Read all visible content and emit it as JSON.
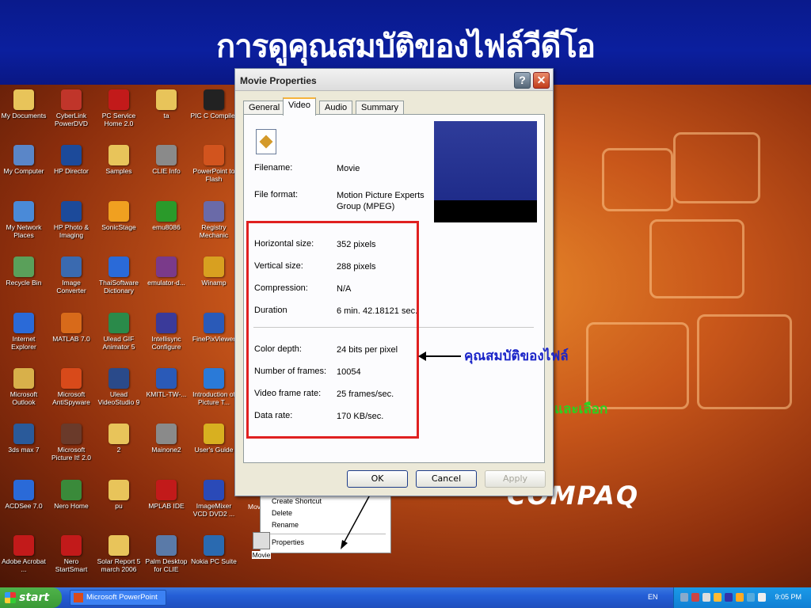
{
  "slide": {
    "title": "การดูคุณสมบัติของไฟล์วีดีโอ"
  },
  "desktop": {
    "icons": [
      {
        "label": "My Documents",
        "glyph": "folder-documents-icon",
        "color": "#e8c45a"
      },
      {
        "label": "CyberLink PowerDVD",
        "glyph": "powerdvd-icon",
        "color": "#c0352a"
      },
      {
        "label": "PC Service Home 2.0",
        "glyph": "pc-service-icon",
        "color": "#c21a1a"
      },
      {
        "label": "ta",
        "glyph": "folder-icon",
        "color": "#e8c45a"
      },
      {
        "label": "PIC C Compiler",
        "glyph": "pic-compiler-icon",
        "color": "#222222"
      },
      {
        "label": "My Computer",
        "glyph": "my-computer-icon",
        "color": "#5a86c8"
      },
      {
        "label": "HP Director",
        "glyph": "hp-director-icon",
        "color": "#1c4a9a"
      },
      {
        "label": "Samples",
        "glyph": "folder-icon",
        "color": "#e8c45a"
      },
      {
        "label": "CLIE Info",
        "glyph": "clie-info-icon",
        "color": "#8a8a8a"
      },
      {
        "label": "PowerPoint to Flash",
        "glyph": "ppt-flash-icon",
        "color": "#d2541e"
      },
      {
        "label": "My Network Places",
        "glyph": "network-places-icon",
        "color": "#4a8ad8"
      },
      {
        "label": "HP Photo & Imaging",
        "glyph": "hp-photo-icon",
        "color": "#1c4a9a"
      },
      {
        "label": "SonicStage",
        "glyph": "sonicstage-icon",
        "color": "#f0a020"
      },
      {
        "label": "emu8086",
        "glyph": "emu8086-icon",
        "color": "#2a9a2a"
      },
      {
        "label": "Registry Mechanic",
        "glyph": "registry-icon",
        "color": "#6a6aa8"
      },
      {
        "label": "Recycle Bin",
        "glyph": "recycle-bin-icon",
        "color": "#5aa05a"
      },
      {
        "label": "Image Converter",
        "glyph": "image-converter-icon",
        "color": "#3a6ab0"
      },
      {
        "label": "ThaiSoftware Dictionary",
        "glyph": "dictionary-icon",
        "color": "#2a6ad8"
      },
      {
        "label": "emulator-d...",
        "glyph": "winrar-icon",
        "color": "#7a3a8a"
      },
      {
        "label": "Winamp",
        "glyph": "winamp-icon",
        "color": "#d8a020"
      },
      {
        "label": "Internet Explorer",
        "glyph": "internet-explorer-icon",
        "color": "#2a6ad8"
      },
      {
        "label": "MATLAB 7.0",
        "glyph": "matlab-icon",
        "color": "#d86a1a"
      },
      {
        "label": "Ulead GIF Animator 5",
        "glyph": "gif-animator-icon",
        "color": "#2a8a4a"
      },
      {
        "label": "Intellisync Configure",
        "glyph": "intellisync-icon",
        "color": "#3a3a9a"
      },
      {
        "label": "FinePixViewer",
        "glyph": "finepix-icon",
        "color": "#2a5ab8"
      },
      {
        "label": "Microsoft Outlook",
        "glyph": "outlook-icon",
        "color": "#d8b04a"
      },
      {
        "label": "Microsoft AntiSpyware",
        "glyph": "antispyware-icon",
        "color": "#d84a1a"
      },
      {
        "label": "Ulead VideoStudio 9",
        "glyph": "videostudio-icon",
        "color": "#2a4a8a"
      },
      {
        "label": "KMITL-TW-...",
        "glyph": "word-document-icon",
        "color": "#2a5ab8"
      },
      {
        "label": "Introduction of Picture T...",
        "glyph": "ie-shortcut-icon",
        "color": "#2a7ad8"
      },
      {
        "label": "3ds max 7",
        "glyph": "3dsmax-icon",
        "color": "#2a5a9a"
      },
      {
        "label": "Microsoft Picture It! 2.0",
        "glyph": "picture-it-icon",
        "color": "#6a3a2a"
      },
      {
        "label": "2",
        "glyph": "folder-icon",
        "color": "#e8c45a"
      },
      {
        "label": "Mainone2",
        "glyph": "mainone-icon",
        "color": "#8a8a8a"
      },
      {
        "label": "User's Guide",
        "glyph": "users-guide-icon",
        "color": "#d8b020"
      },
      {
        "label": "ACDSee 7.0",
        "glyph": "acdsee-icon",
        "color": "#2a6ad8"
      },
      {
        "label": "Nero Home",
        "glyph": "nero-home-icon",
        "color": "#3a8a3a"
      },
      {
        "label": "pu",
        "glyph": "folder-icon",
        "color": "#e8c45a"
      },
      {
        "label": "MPLAB IDE",
        "glyph": "mplab-icon",
        "color": "#c21a1a"
      },
      {
        "label": "ImageMixer VCD DVD2 ...",
        "glyph": "imagemixer-icon",
        "color": "#2a4ab8"
      },
      {
        "label": "Adobe Acrobat ...",
        "glyph": "acrobat-icon",
        "color": "#c21a1a"
      },
      {
        "label": "Nero StartSmart",
        "glyph": "nero-icon",
        "color": "#c21a1a"
      },
      {
        "label": "Solar Report 5 march 2006",
        "glyph": "folder-icon",
        "color": "#e8c45a"
      },
      {
        "label": "Palm Desktop for CLIE",
        "glyph": "palm-desktop-icon",
        "color": "#5a7aa8"
      },
      {
        "label": "Nokia PC Suite",
        "glyph": "nokia-suite-icon",
        "color": "#2a6ab0"
      }
    ],
    "movie_file_label": "Movie",
    "partial_label": "Mov",
    "context_menu": {
      "items": [
        "Create Shortcut",
        "Delete",
        "Rename",
        "Properties"
      ]
    },
    "brand_text": "COMPAQ",
    "green_note": "และเลือก"
  },
  "dialog": {
    "title": "Movie Properties",
    "help_label": "?",
    "close_label": "✕",
    "tabs": [
      "General",
      "Video",
      "Audio",
      "Summary"
    ],
    "active_tab": "Video",
    "filename_label": "Filename:",
    "filename_value": "Movie",
    "format_label": "File format:",
    "format_value": "Motion Picture Experts Group (MPEG)",
    "props_group1": [
      {
        "label": "Horizontal size:",
        "value": "352 pixels"
      },
      {
        "label": "Vertical size:",
        "value": "288 pixels"
      },
      {
        "label": "Compression:",
        "value": "N/A"
      },
      {
        "label": "Duration",
        "value": "6 min. 42.18121 sec."
      }
    ],
    "props_group2": [
      {
        "label": "Color depth:",
        "value": "24 bits per pixel"
      },
      {
        "label": "Number of frames:",
        "value": "10054"
      },
      {
        "label": "Video frame rate:",
        "value": "25 frames/sec."
      },
      {
        "label": "Data rate:",
        "value": "170 KB/sec."
      }
    ],
    "buttons": {
      "ok": "OK",
      "cancel": "Cancel",
      "apply": "Apply"
    }
  },
  "annotation": {
    "text": "คุณสมบัติของไฟล์",
    "highlight_color": "#e02020"
  },
  "taskbar": {
    "start_label": "start",
    "task_item": "Microsoft PowerPoint ...",
    "language": "EN",
    "clock": "9:05 PM"
  }
}
